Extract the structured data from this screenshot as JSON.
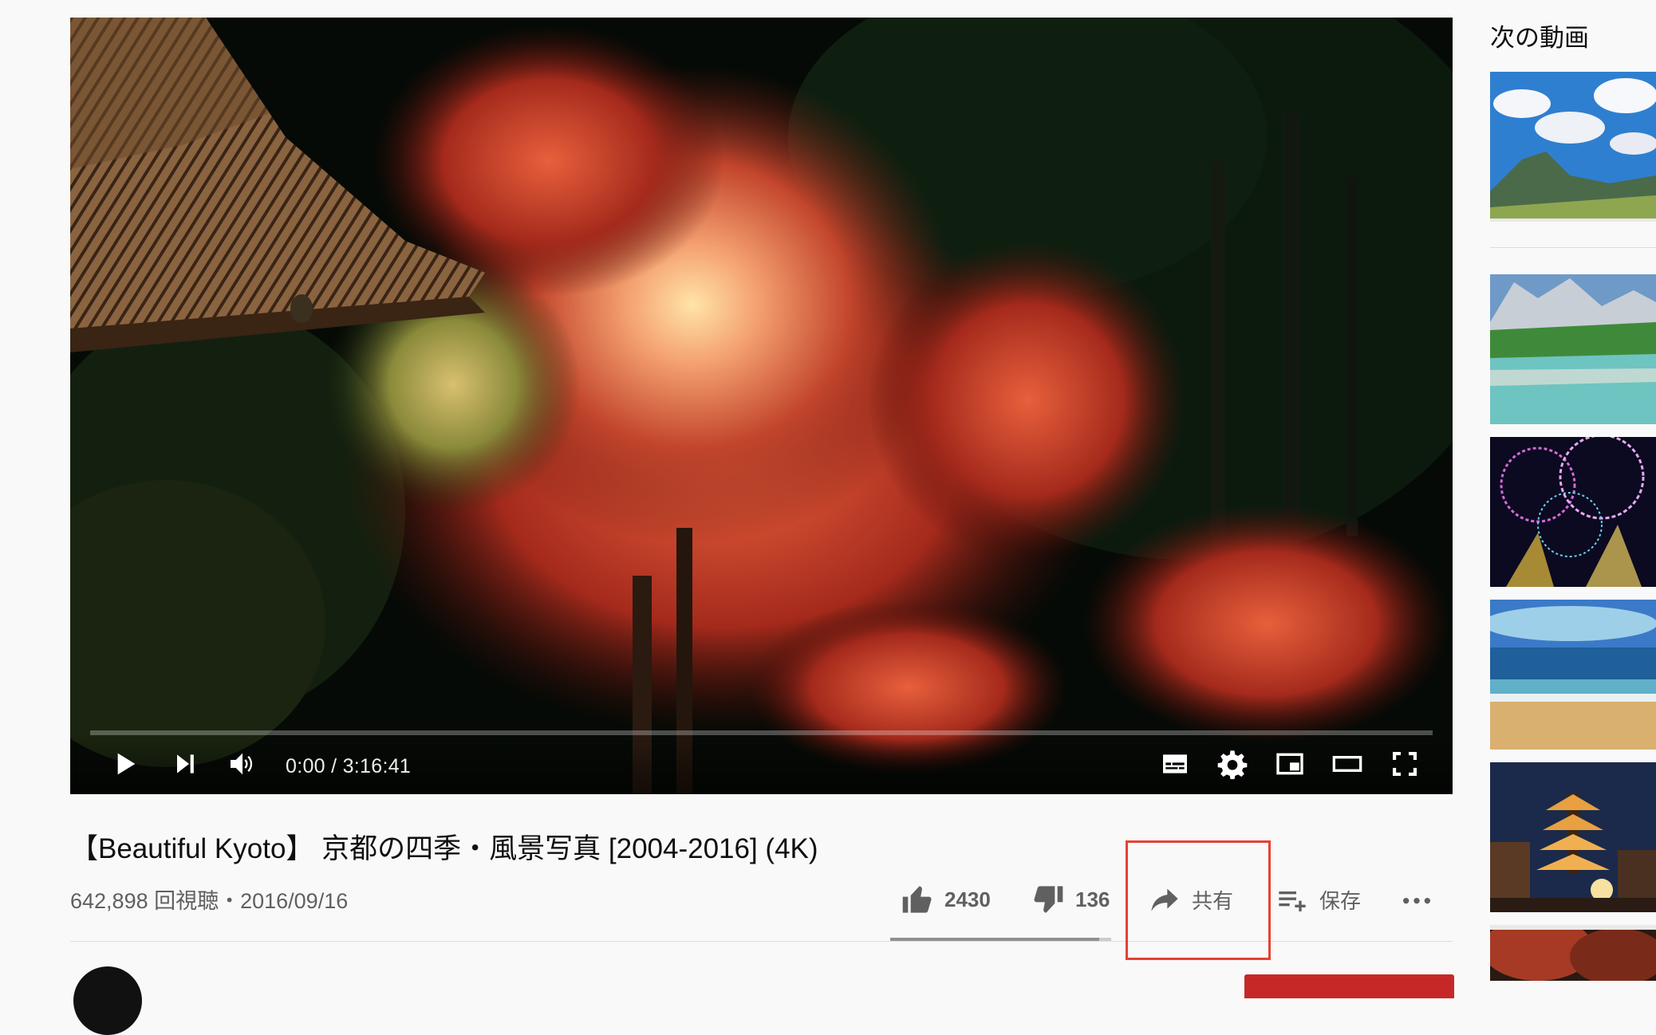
{
  "player": {
    "time_current": "0:00",
    "time_total": "3:16:41",
    "time_display": "0:00 / 3:16:41",
    "progress_fraction": 0.0,
    "buffered_fraction": 0.0,
    "controls": {
      "play": "play-icon",
      "next": "next-icon",
      "volume": "volume-icon",
      "subtitles": "subtitles-icon",
      "settings": "gear-icon",
      "miniplayer": "miniplayer-icon",
      "theater": "theater-mode-icon",
      "fullscreen": "fullscreen-icon"
    }
  },
  "video": {
    "title": "【Beautiful Kyoto】 京都の四季・風景写真 [2004-2016] (4K)",
    "view_info": "642,898 回視聴・2016/09/16"
  },
  "actions": {
    "like_count": "2430",
    "dislike_count": "136",
    "share_label": "共有",
    "save_label": "保存",
    "like_ratio": 0.947
  },
  "sidebar": {
    "up_next_label": "次の動画",
    "thumbnails": [
      {
        "name": "mountain-sky-thumbnail"
      },
      {
        "name": "river-alps-thumbnail"
      },
      {
        "name": "fireworks-thumbnail"
      },
      {
        "name": "beach-thumbnail"
      },
      {
        "name": "pagoda-night-thumbnail"
      },
      {
        "name": "autumn-garden-thumbnail"
      }
    ]
  },
  "colors": {
    "highlight_box": "#e34234",
    "subscribe": "#c62828",
    "secondary_text": "#606060"
  }
}
